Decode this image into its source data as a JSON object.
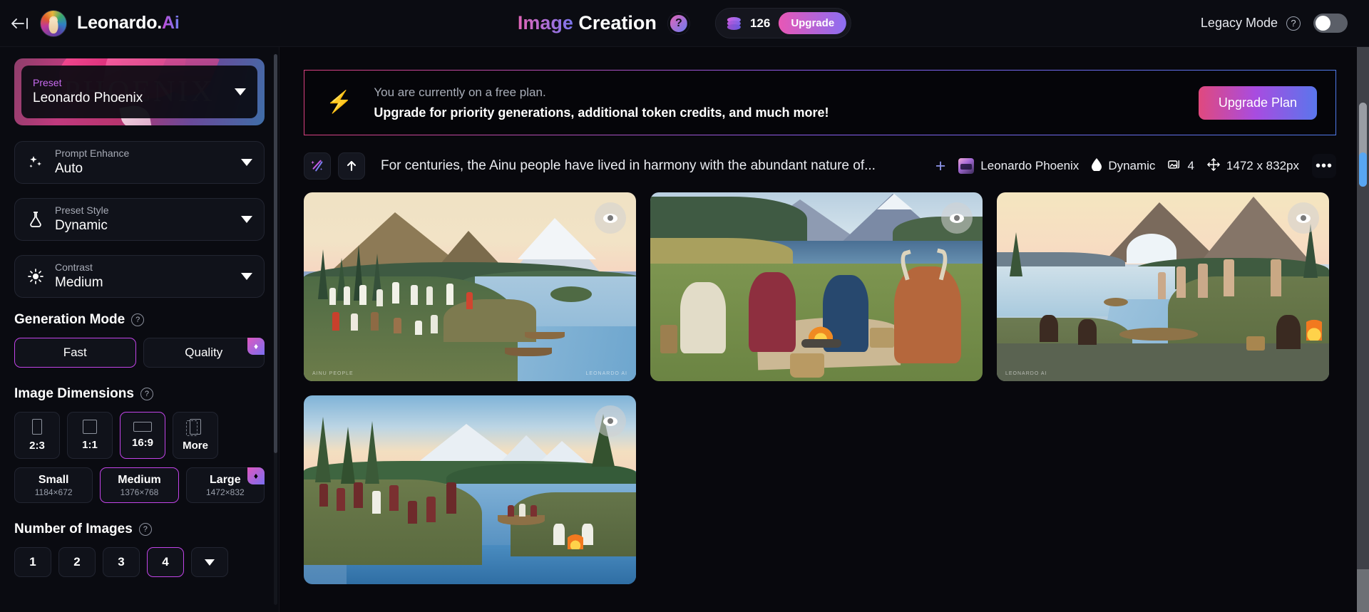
{
  "app": {
    "brand_name": "Leonardo.",
    "brand_suffix": "Ai",
    "page_title_accent": "Image",
    "page_title_main": "Creation",
    "help_glyph": "?",
    "token_count": "126",
    "upgrade_chip_label": "Upgrade",
    "legacy_mode_label": "Legacy Mode",
    "legacy_help_glyph": "?"
  },
  "sidebar": {
    "preset": {
      "label": "Preset",
      "value": "Leonardo Phoenix",
      "art_word": "PHOENIX"
    },
    "prompt_enhance": {
      "label": "Prompt Enhance",
      "value": "Auto",
      "icon": "sparkles-icon"
    },
    "preset_style": {
      "label": "Preset Style",
      "value": "Dynamic",
      "icon": "flask-icon"
    },
    "contrast": {
      "label": "Contrast",
      "value": "Medium",
      "icon": "sun-icon"
    },
    "generation_mode": {
      "title": "Generation Mode",
      "help_glyph": "?",
      "options": [
        {
          "label": "Fast",
          "selected": true,
          "premium": false
        },
        {
          "label": "Quality",
          "selected": false,
          "premium": true,
          "premium_glyph": "♦"
        }
      ]
    },
    "image_dimensions": {
      "title": "Image Dimensions",
      "help_glyph": "?",
      "ratios": [
        {
          "label": "2:3",
          "selected": false
        },
        {
          "label": "1:1",
          "selected": false
        },
        {
          "label": "16:9",
          "selected": true
        },
        {
          "label": "More",
          "selected": false
        }
      ],
      "sizes": [
        {
          "name": "Small",
          "dims": "1184×672",
          "selected": false,
          "premium": false
        },
        {
          "name": "Medium",
          "dims": "1376×768",
          "selected": true,
          "premium": false
        },
        {
          "name": "Large",
          "dims": "1472×832",
          "selected": false,
          "premium": true,
          "premium_glyph": "♦"
        }
      ]
    },
    "number_of_images": {
      "title": "Number of Images",
      "help_glyph": "?",
      "options": [
        {
          "label": "1",
          "selected": false
        },
        {
          "label": "2",
          "selected": false
        },
        {
          "label": "3",
          "selected": false
        },
        {
          "label": "4",
          "selected": true
        }
      ]
    }
  },
  "banner": {
    "icon": "lightning-bolt-icon",
    "line1": "You are currently on a free plan.",
    "line2": "Upgrade for priority generations, additional token credits, and much more!",
    "cta_label": "Upgrade Plan"
  },
  "generation": {
    "prompt": "For centuries, the Ainu people have lived in harmony with the abundant nature of...",
    "add_label": "+",
    "model_name": "Leonardo Phoenix",
    "style_name": "Dynamic",
    "image_count": "4",
    "resolution": "1472 x 832px",
    "more_glyph": "•••",
    "results": [
      {
        "name": "result-image-1",
        "watermark_left": "AINU PEOPLE",
        "watermark_right": "LEONARDO AI"
      },
      {
        "name": "result-image-2",
        "watermark_left": "",
        "watermark_right": ""
      },
      {
        "name": "result-image-3",
        "watermark_left": "LEONARDO AI",
        "watermark_right": ""
      },
      {
        "name": "result-image-4",
        "watermark_left": "",
        "watermark_right": ""
      }
    ]
  },
  "colors": {
    "accent_pink": "#c244e8",
    "accent_blue": "#5a76ec",
    "bg": "#0a0b11",
    "bolt_yellow": "#f0b429"
  }
}
